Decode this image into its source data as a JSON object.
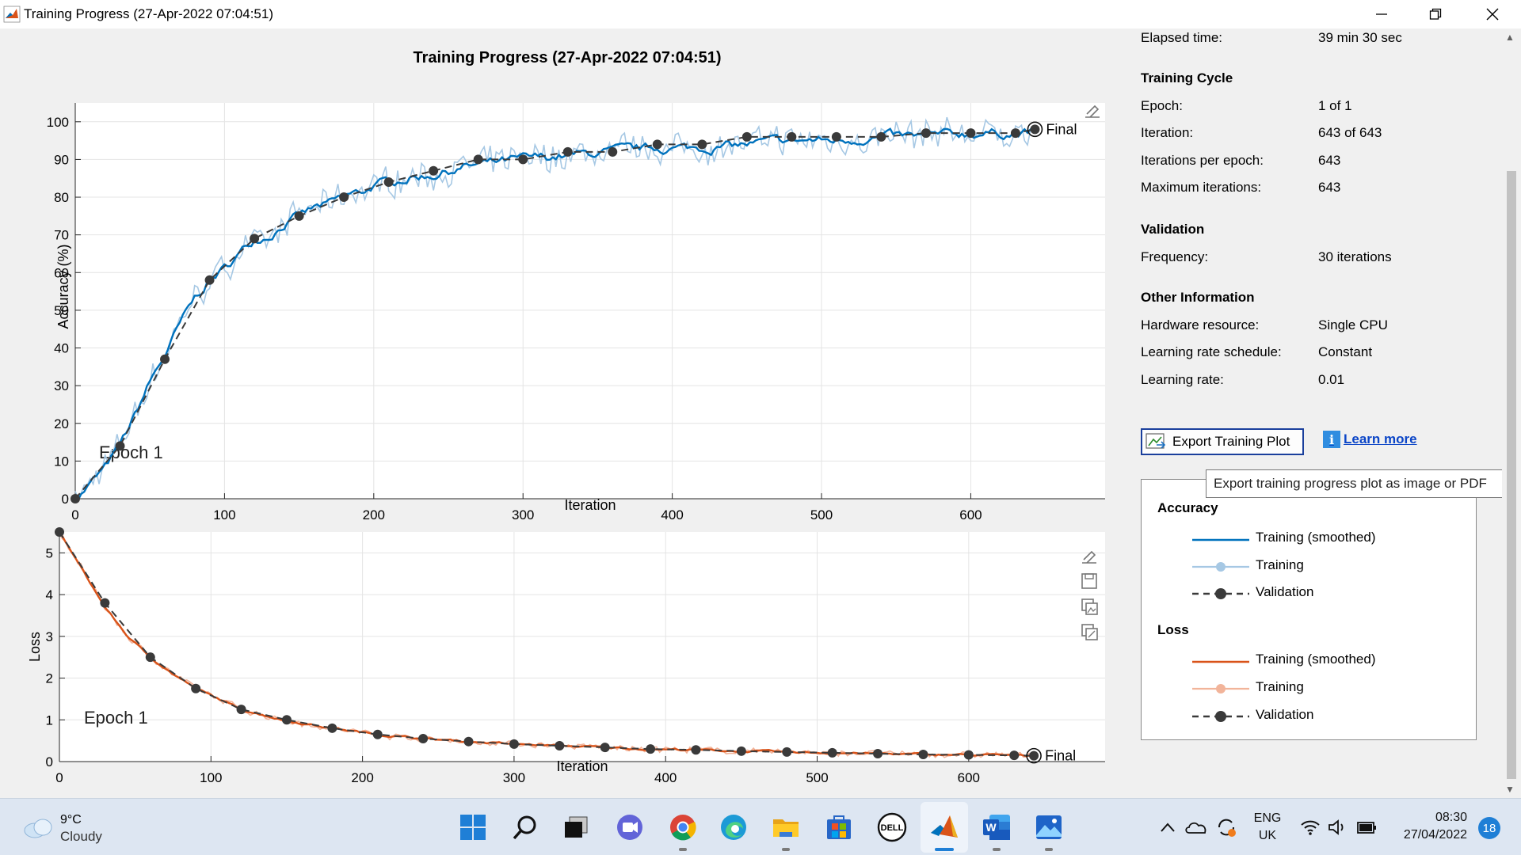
{
  "window": {
    "title": "Training Progress (27-Apr-2022 07:04:51)",
    "controls": [
      "minimize-icon",
      "restore-icon",
      "close-icon"
    ]
  },
  "plot_title": "Training Progress (27-Apr-2022 07:04:51)",
  "accuracy_plot": {
    "ylabel": "Accuracy (%)",
    "xlabel": "Iteration",
    "epoch_label": "Epoch 1",
    "final_label": "Final"
  },
  "loss_plot": {
    "ylabel": "Loss",
    "xlabel": "Iteration",
    "epoch_label": "Epoch 1",
    "final_label": "Final"
  },
  "info": {
    "elapsed": {
      "label": "Elapsed time:",
      "value": "39 min 30 sec"
    },
    "training_cycle": {
      "heading": "Training Cycle",
      "epoch": {
        "label": "Epoch:",
        "value": "1 of 1"
      },
      "iteration": {
        "label": "Iteration:",
        "value": "643 of 643"
      },
      "iter_per_epoch": {
        "label": "Iterations per epoch:",
        "value": "643"
      },
      "max_iter": {
        "label": "Maximum iterations:",
        "value": "643"
      }
    },
    "validation": {
      "heading": "Validation",
      "frequency": {
        "label": "Frequency:",
        "value": "30 iterations"
      }
    },
    "other": {
      "heading": "Other Information",
      "hardware": {
        "label": "Hardware resource:",
        "value": "Single CPU"
      },
      "lr_schedule": {
        "label": "Learning rate schedule:",
        "value": "Constant"
      },
      "lr": {
        "label": "Learning rate:",
        "value": "0.01"
      }
    }
  },
  "export_button": {
    "label": "Export Training Plot",
    "tooltip": "Export training progress plot as image or PDF"
  },
  "learn_more": {
    "label": "Learn more"
  },
  "legend": {
    "accuracy_heading": "Accuracy",
    "accuracy_items": [
      "Training (smoothed)",
      "Training",
      "Validation"
    ],
    "loss_heading": "Loss",
    "loss_items": [
      "Training (smoothed)",
      "Training",
      "Validation"
    ]
  },
  "colors": {
    "accuracy_smoothed": "#0072bd",
    "accuracy_raw": "#a6c8e4",
    "loss_smoothed": "#d95319",
    "loss_raw": "#f2b49a",
    "validation": "#3a3a3a"
  },
  "taskbar": {
    "weather": {
      "temp": "9°C",
      "condition": "Cloudy"
    },
    "apps": [
      "start-icon",
      "search-icon",
      "task-view-icon",
      "chat-icon",
      "chrome-icon",
      "edge-icon",
      "file-explorer-icon",
      "store-icon",
      "dell-icon",
      "matlab-icon",
      "word-icon",
      "photos-icon"
    ],
    "tray": {
      "lang1": "ENG",
      "lang2": "UK",
      "time": "08:30",
      "date": "27/04/2022",
      "notifications": "18"
    }
  },
  "chart_data": [
    {
      "type": "line",
      "title": "Training Progress (27-Apr-2022 07:04:51)",
      "xlabel": "Iteration",
      "ylabel": "Accuracy (%)",
      "xlim": [
        0,
        690
      ],
      "ylim": [
        0,
        105
      ],
      "xticks": [
        0,
        100,
        200,
        300,
        400,
        500,
        600
      ],
      "yticks": [
        0,
        10,
        20,
        30,
        40,
        50,
        60,
        70,
        80,
        90,
        100
      ],
      "grid": true,
      "series": [
        {
          "name": "Training (smoothed)",
          "x": [
            0,
            10,
            20,
            30,
            40,
            50,
            60,
            70,
            80,
            90,
            100,
            110,
            120,
            130,
            140,
            150,
            160,
            170,
            180,
            190,
            200,
            220,
            240,
            260,
            280,
            300,
            330,
            360,
            390,
            420,
            450,
            480,
            510,
            540,
            570,
            600,
            630,
            643
          ],
          "y": [
            0,
            4,
            8,
            14,
            22,
            31,
            38,
            46,
            53,
            58,
            61,
            65,
            69,
            70,
            73,
            75,
            77,
            78,
            80,
            81,
            83,
            85,
            86,
            88,
            89,
            90,
            91,
            92,
            93,
            93,
            94,
            95,
            95,
            96,
            96,
            97,
            97,
            97
          ]
        },
        {
          "name": "Validation",
          "x": [
            0,
            30,
            60,
            90,
            120,
            150,
            180,
            210,
            240,
            270,
            300,
            330,
            360,
            390,
            420,
            450,
            480,
            510,
            540,
            570,
            600,
            630,
            643
          ],
          "y": [
            0,
            14,
            37,
            58,
            69,
            75,
            80,
            84,
            87,
            90,
            90,
            92,
            92,
            94,
            94,
            96,
            96,
            96,
            96,
            97,
            97,
            97,
            98
          ]
        }
      ]
    },
    {
      "type": "line",
      "xlabel": "Iteration",
      "ylabel": "Loss",
      "xlim": [
        0,
        690
      ],
      "ylim": [
        0,
        5.5
      ],
      "xticks": [
        0,
        100,
        200,
        300,
        400,
        500,
        600
      ],
      "yticks": [
        0,
        1,
        2,
        3,
        4,
        5
      ],
      "grid": true,
      "series": [
        {
          "name": "Training (smoothed)",
          "x": [
            0,
            15,
            30,
            45,
            60,
            75,
            90,
            105,
            120,
            150,
            180,
            210,
            240,
            270,
            300,
            330,
            360,
            390,
            420,
            450,
            480,
            510,
            540,
            570,
            600,
            630,
            643
          ],
          "y": [
            5.5,
            4.6,
            3.7,
            3.0,
            2.5,
            2.1,
            1.75,
            1.5,
            1.25,
            0.98,
            0.8,
            0.65,
            0.55,
            0.48,
            0.42,
            0.38,
            0.34,
            0.3,
            0.28,
            0.25,
            0.23,
            0.21,
            0.19,
            0.17,
            0.16,
            0.15,
            0.14
          ]
        },
        {
          "name": "Validation",
          "x": [
            0,
            30,
            60,
            90,
            120,
            150,
            180,
            210,
            240,
            270,
            300,
            330,
            360,
            390,
            420,
            450,
            480,
            510,
            540,
            570,
            600,
            630,
            643
          ],
          "y": [
            5.5,
            3.8,
            2.5,
            1.75,
            1.25,
            1.0,
            0.8,
            0.65,
            0.55,
            0.48,
            0.42,
            0.38,
            0.34,
            0.3,
            0.28,
            0.25,
            0.23,
            0.21,
            0.19,
            0.17,
            0.16,
            0.15,
            0.14
          ]
        }
      ]
    }
  ]
}
